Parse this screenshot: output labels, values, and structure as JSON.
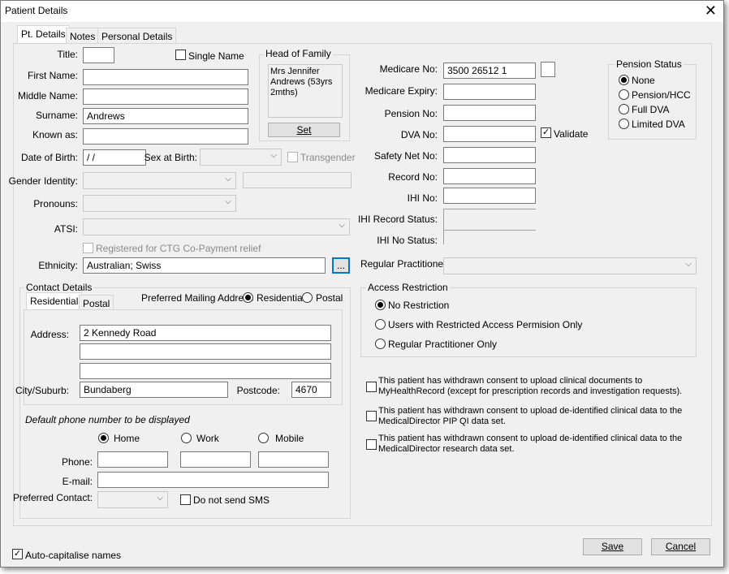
{
  "window": {
    "title": "Patient Details"
  },
  "tabs": [
    "Pt. Details",
    "Notes",
    "Personal Details"
  ],
  "form": {
    "title_label": "Title:",
    "title_value": "",
    "single_name_label": "Single Name",
    "first_name_label": "First Name:",
    "first_name_value": "",
    "middle_name_label": "Middle Name:",
    "middle_name_value": "",
    "surname_label": "Surname:",
    "surname_value": "Andrews",
    "known_as_label": "Known as:",
    "known_as_value": "",
    "dob_label": "Date of Birth:",
    "dob_value": " /  /",
    "sex_label": "Sex at Birth:",
    "transgender_label": "Transgender",
    "gender_label": "Gender Identity:",
    "pronouns_label": "Pronouns:",
    "atsi_label": "ATSI:",
    "ctg_label": "Registered for CTG Co-Payment relief",
    "ethnicity_label": "Ethnicity:",
    "ethnicity_value": "Australian; Swiss",
    "ethnicity_btn": "..."
  },
  "head_of_family": {
    "title": "Head of Family",
    "lines": [
      "Mrs Jennifer",
      "Andrews (53yrs",
      "2mths)"
    ],
    "set_btn": "Set"
  },
  "contact": {
    "title": "Contact Details",
    "tabs": [
      "Residential",
      "Postal"
    ],
    "mailing_label": "Preferred Mailing Address",
    "mailing_options": [
      "Residential",
      "Postal"
    ],
    "address_label": "Address:",
    "address_lines": [
      "2 Kennedy Road",
      "",
      ""
    ],
    "city_label": "City/Suburb:",
    "city_value": "Bundaberg",
    "postcode_label": "Postcode:",
    "postcode_value": "4670",
    "default_phone_label": "Default phone number to be displayed",
    "phone_options": [
      "Home",
      "Work",
      "Mobile"
    ],
    "phone_label": "Phone:",
    "email_label": "E-mail:",
    "preferred_contact_label": "Preferred Contact:",
    "no_sms_label": "Do not send SMS"
  },
  "medicare": {
    "medicare_no_label": "Medicare No:",
    "medicare_no_value": "3500 26512 1",
    "medicare_expiry_label": "Medicare Expiry:",
    "pension_no_label": "Pension No:",
    "dva_no_label": "DVA No:",
    "validate_label": "Validate",
    "safety_net_label": "Safety Net No:",
    "record_no_label": "Record No:",
    "ihi_no_label": "IHI No:",
    "ihi_record_status_label": "IHI Record Status:",
    "ihi_no_status_label": "IHI No Status:",
    "regular_practitioner_label": "Regular Practitioner:"
  },
  "pension_status": {
    "title": "Pension Status",
    "options": [
      "None",
      "Pension/HCC",
      "Full DVA",
      "Limited DVA"
    ]
  },
  "access": {
    "title": "Access Restriction",
    "options": [
      "No Restriction",
      "Users with Restricted Access Permision Only",
      "Regular Practitioner Only"
    ]
  },
  "consents": [
    [
      "This patient has withdrawn consent to upload clinical documents to",
      "MyHealthRecord (except for prescription records and investigation requests)."
    ],
    [
      "This patient has withdrawn consent to upload de-identified clinical data to the",
      "MedicalDirector PIP QI data set."
    ],
    [
      "This patient has withdrawn consent to upload de-identified clinical data to the",
      "MedicalDirector research data set."
    ]
  ],
  "footer": {
    "auto_cap_label": "Auto-capitalise names",
    "save": "Save",
    "cancel": "Cancel"
  }
}
